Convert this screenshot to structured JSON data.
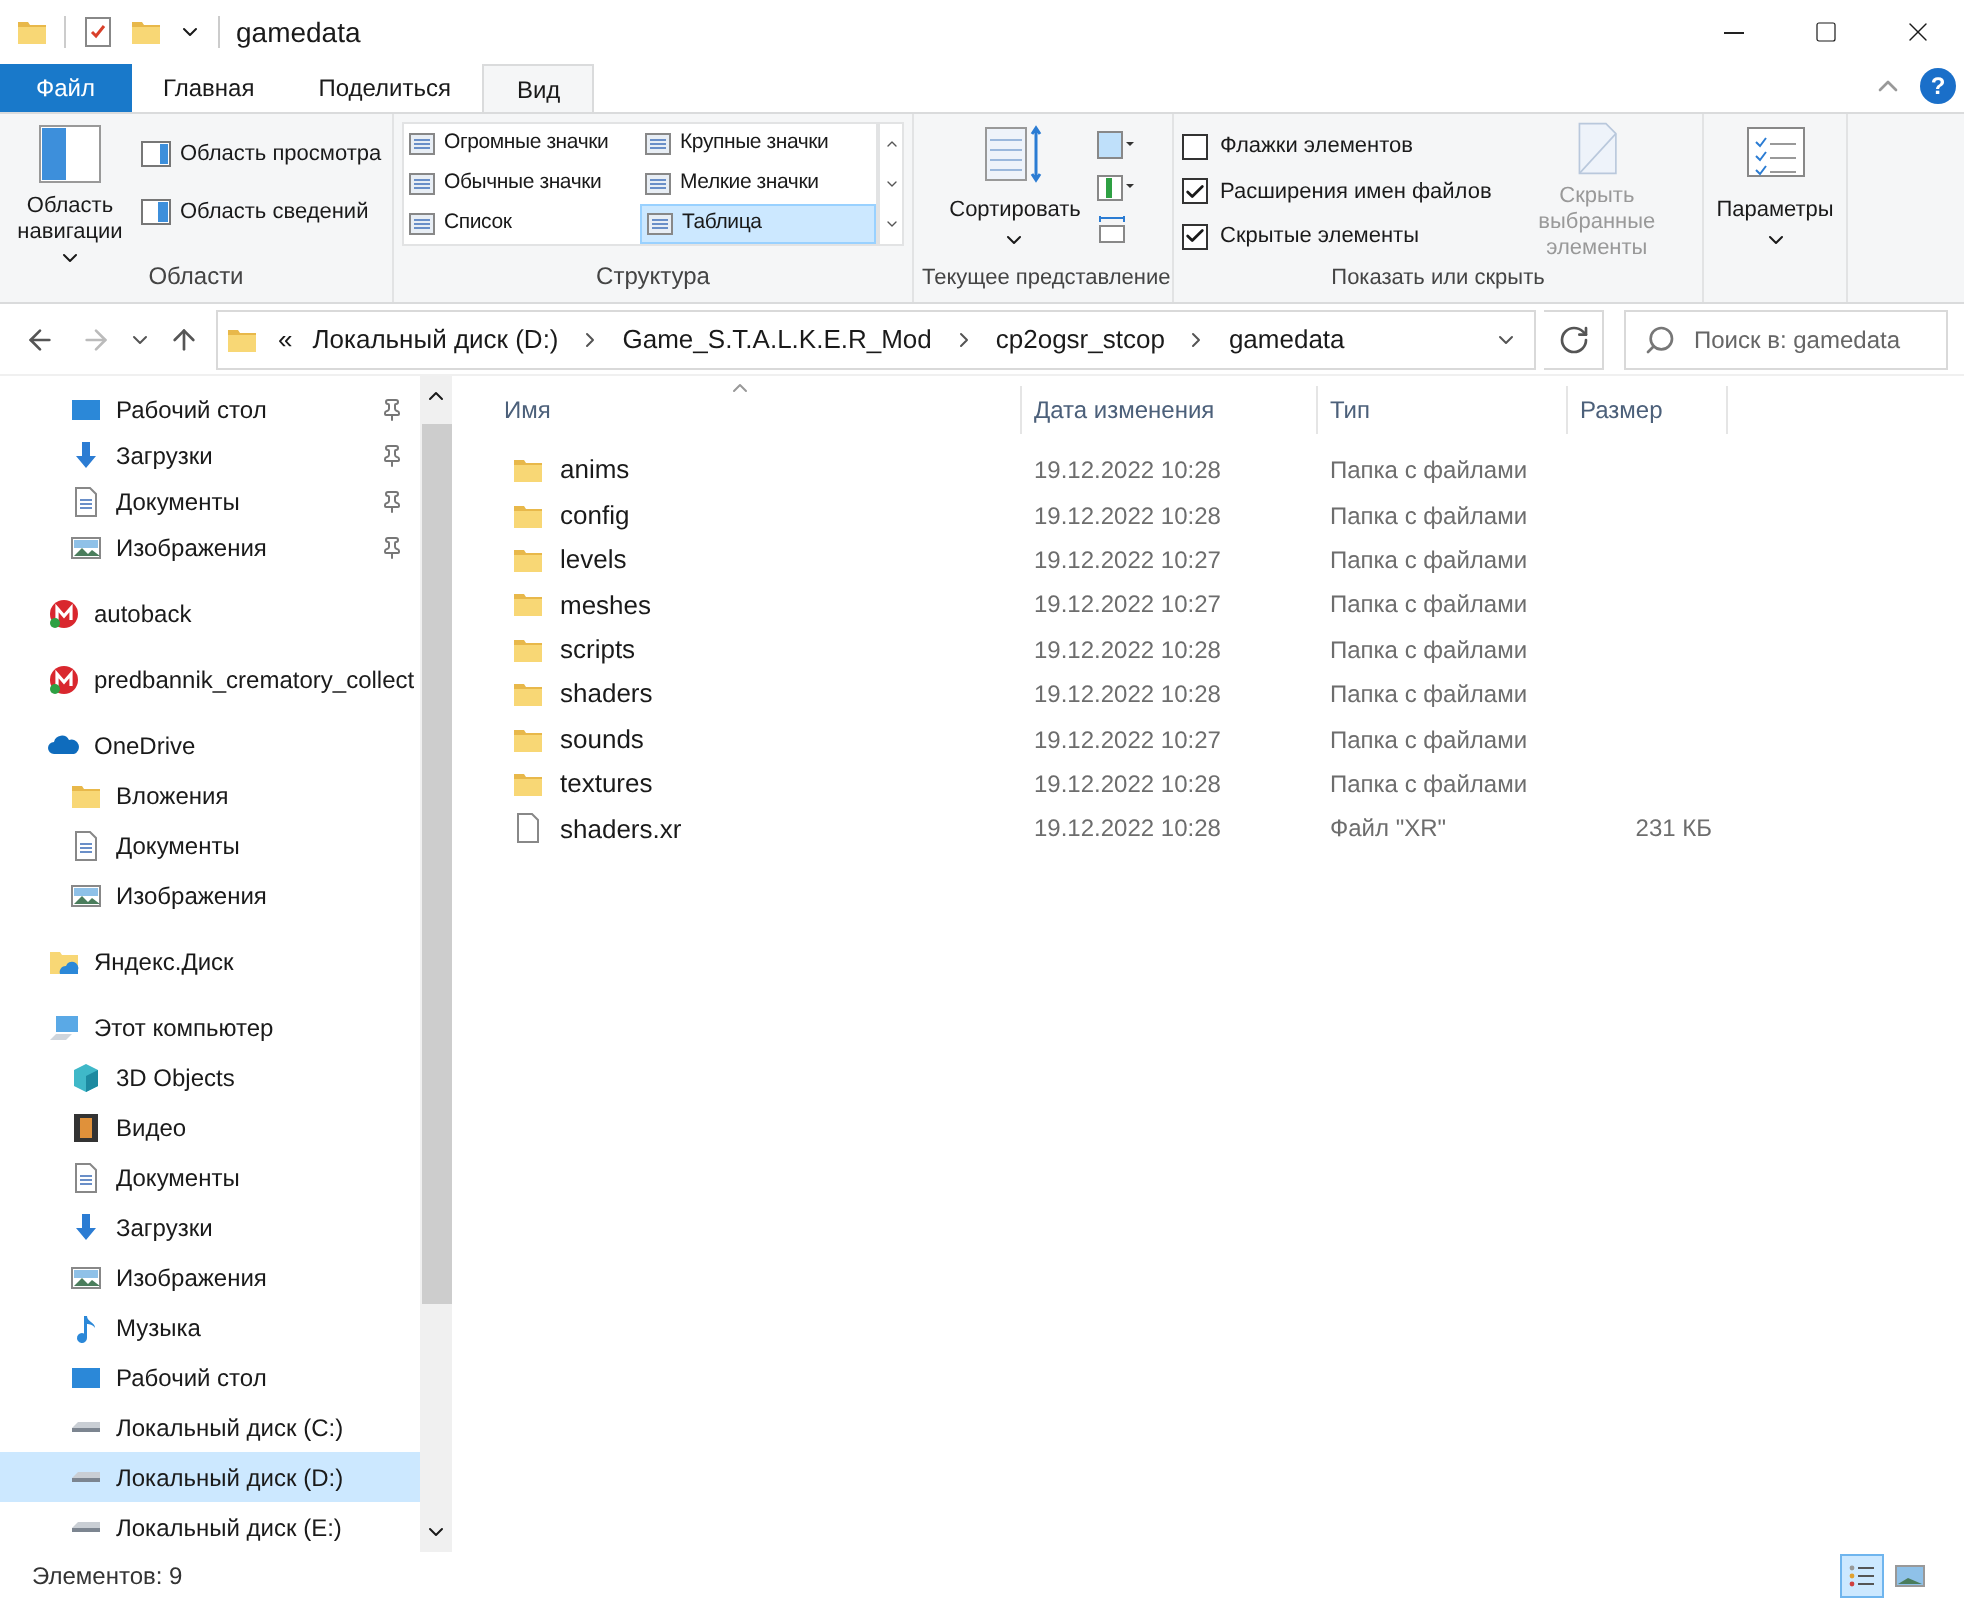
{
  "window": {
    "title": "gamedata"
  },
  "ribbon_tabs": [
    {
      "label": "Файл",
      "kind": "file",
      "selected": false
    },
    {
      "label": "Главная",
      "kind": "tab",
      "selected": false
    },
    {
      "label": "Поделиться",
      "kind": "tab",
      "selected": false
    },
    {
      "label": "Вид",
      "kind": "tab",
      "selected": true
    }
  ],
  "help": "?",
  "ribbon": {
    "panes": {
      "label": "Области",
      "navigation_pane": "Область навигации",
      "preview_pane": "Область просмотра",
      "details_pane": "Область сведений"
    },
    "layout": {
      "label": "Структура",
      "options": [
        {
          "label": "Огромные значки",
          "selected": false
        },
        {
          "label": "Крупные значки",
          "selected": false
        },
        {
          "label": "Обычные значки",
          "selected": false
        },
        {
          "label": "Мелкие значки",
          "selected": false
        },
        {
          "label": "Список",
          "selected": false
        },
        {
          "label": "Таблица",
          "selected": true
        }
      ]
    },
    "current_view": {
      "label": "Текущее представление",
      "sort": "Сортировать"
    },
    "show_hide": {
      "label": "Показать или скрыть",
      "checkboxes": [
        {
          "label": "Флажки элементов",
          "checked": false
        },
        {
          "label": "Расширения имен файлов",
          "checked": true
        },
        {
          "label": "Скрытые элементы",
          "checked": true
        }
      ],
      "hide_selected": {
        "label": "Скрыть выбранные элементы",
        "disabled": true
      }
    },
    "options": {
      "label": "Параметры"
    }
  },
  "address": {
    "crumbs": [
      "«",
      "Локальный диск (D:)",
      "Game_S.T.A.L.K.E.R_Mod",
      "cp2ogsr_stcop",
      "gamedata"
    ],
    "search_placeholder": "Поиск в: gamedata"
  },
  "quick_access": [
    {
      "label": "Рабочий стол",
      "kind": "desktop",
      "pinned": true
    },
    {
      "label": "Загрузки",
      "kind": "download",
      "pinned": true
    },
    {
      "label": "Документы",
      "kind": "document",
      "pinned": true
    },
    {
      "label": "Изображения",
      "kind": "picture",
      "pinned": true
    }
  ],
  "nav_tree": [
    {
      "label": "autoback",
      "kind": "mega",
      "selected": false
    },
    {
      "label": "predbannik_crematory_collect",
      "kind": "mega",
      "selected": false
    },
    {
      "label": "OneDrive",
      "kind": "cloud",
      "selected": false,
      "children": [
        {
          "label": "Вложения",
          "kind": "folder",
          "selected": false
        },
        {
          "label": "Документы",
          "kind": "document",
          "selected": false
        },
        {
          "label": "Изображения",
          "kind": "picture",
          "selected": false
        }
      ]
    },
    {
      "label": "Яндекс.Диск",
      "kind": "yandex",
      "selected": false
    },
    {
      "label": "Этот компьютер",
      "kind": "computer",
      "selected": false,
      "children": [
        {
          "label": "3D Objects",
          "kind": "cube",
          "selected": false
        },
        {
          "label": "Видео",
          "kind": "video",
          "selected": false
        },
        {
          "label": "Документы",
          "kind": "document",
          "selected": false
        },
        {
          "label": "Загрузки",
          "kind": "download",
          "selected": false
        },
        {
          "label": "Изображения",
          "kind": "picture",
          "selected": false
        },
        {
          "label": "Музыка",
          "kind": "music",
          "selected": false
        },
        {
          "label": "Рабочий стол",
          "kind": "desktop",
          "selected": false
        },
        {
          "label": "Локальный диск (C:)",
          "kind": "drive",
          "selected": false
        },
        {
          "label": "Локальный диск (D:)",
          "kind": "drive",
          "selected": true
        },
        {
          "label": "Локальный диск (E:)",
          "kind": "drive",
          "selected": false
        }
      ]
    }
  ],
  "table": {
    "columns": [
      "Имя",
      "Дата изменения",
      "Тип",
      "Размер"
    ],
    "rows": [
      {
        "kind": "folder",
        "name": "anims",
        "date": "19.12.2022 10:28",
        "type": "Папка с файлами"
      },
      {
        "kind": "folder",
        "name": "config",
        "date": "19.12.2022 10:28",
        "type": "Папка с файлами"
      },
      {
        "kind": "folder",
        "name": "levels",
        "date": "19.12.2022 10:27",
        "type": "Папка с файлами"
      },
      {
        "kind": "folder",
        "name": "meshes",
        "date": "19.12.2022 10:27",
        "type": "Папка с файлами"
      },
      {
        "kind": "folder",
        "name": "scripts",
        "date": "19.12.2022 10:28",
        "type": "Папка с файлами"
      },
      {
        "kind": "folder",
        "name": "shaders",
        "date": "19.12.2022 10:28",
        "type": "Папка с файлами"
      },
      {
        "kind": "folder",
        "name": "sounds",
        "date": "19.12.2022 10:27",
        "type": "Папка с файлами"
      },
      {
        "kind": "folder",
        "name": "textures",
        "date": "19.12.2022 10:28",
        "type": "Папка с файлами"
      },
      {
        "kind": "file",
        "name": "shaders.xr",
        "date": "19.12.2022 10:28",
        "type": "Файл \"XR\"",
        "size": "231 КБ"
      }
    ]
  },
  "status_bar": {
    "count": "Элементов: 9",
    "views": [
      {
        "kind": "details",
        "selected": true
      },
      {
        "kind": "large",
        "selected": false
      }
    ]
  }
}
